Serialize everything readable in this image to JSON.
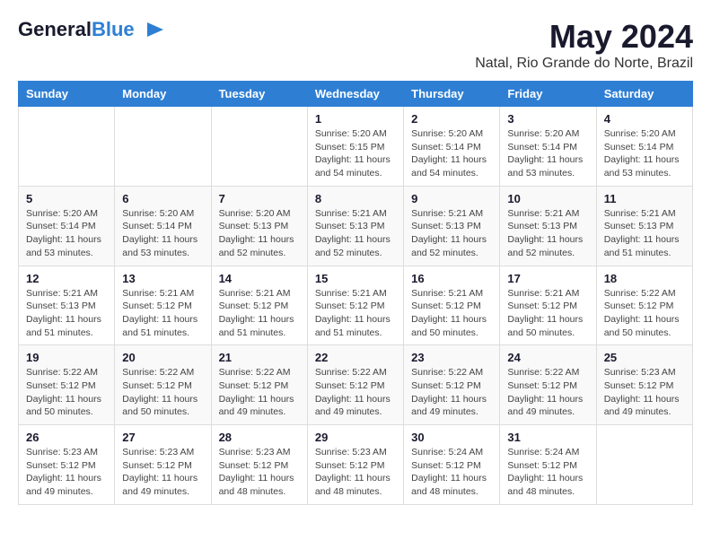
{
  "logo": {
    "general": "General",
    "blue": "Blue"
  },
  "title": {
    "month_year": "May 2024",
    "location": "Natal, Rio Grande do Norte, Brazil"
  },
  "headers": [
    "Sunday",
    "Monday",
    "Tuesday",
    "Wednesday",
    "Thursday",
    "Friday",
    "Saturday"
  ],
  "weeks": [
    [
      {
        "day": "",
        "sunrise": "",
        "sunset": "",
        "daylight": ""
      },
      {
        "day": "",
        "sunrise": "",
        "sunset": "",
        "daylight": ""
      },
      {
        "day": "",
        "sunrise": "",
        "sunset": "",
        "daylight": ""
      },
      {
        "day": "1",
        "sunrise": "Sunrise: 5:20 AM",
        "sunset": "Sunset: 5:15 PM",
        "daylight": "Daylight: 11 hours and 54 minutes."
      },
      {
        "day": "2",
        "sunrise": "Sunrise: 5:20 AM",
        "sunset": "Sunset: 5:14 PM",
        "daylight": "Daylight: 11 hours and 54 minutes."
      },
      {
        "day": "3",
        "sunrise": "Sunrise: 5:20 AM",
        "sunset": "Sunset: 5:14 PM",
        "daylight": "Daylight: 11 hours and 53 minutes."
      },
      {
        "day": "4",
        "sunrise": "Sunrise: 5:20 AM",
        "sunset": "Sunset: 5:14 PM",
        "daylight": "Daylight: 11 hours and 53 minutes."
      }
    ],
    [
      {
        "day": "5",
        "sunrise": "Sunrise: 5:20 AM",
        "sunset": "Sunset: 5:14 PM",
        "daylight": "Daylight: 11 hours and 53 minutes."
      },
      {
        "day": "6",
        "sunrise": "Sunrise: 5:20 AM",
        "sunset": "Sunset: 5:14 PM",
        "daylight": "Daylight: 11 hours and 53 minutes."
      },
      {
        "day": "7",
        "sunrise": "Sunrise: 5:20 AM",
        "sunset": "Sunset: 5:13 PM",
        "daylight": "Daylight: 11 hours and 52 minutes."
      },
      {
        "day": "8",
        "sunrise": "Sunrise: 5:21 AM",
        "sunset": "Sunset: 5:13 PM",
        "daylight": "Daylight: 11 hours and 52 minutes."
      },
      {
        "day": "9",
        "sunrise": "Sunrise: 5:21 AM",
        "sunset": "Sunset: 5:13 PM",
        "daylight": "Daylight: 11 hours and 52 minutes."
      },
      {
        "day": "10",
        "sunrise": "Sunrise: 5:21 AM",
        "sunset": "Sunset: 5:13 PM",
        "daylight": "Daylight: 11 hours and 52 minutes."
      },
      {
        "day": "11",
        "sunrise": "Sunrise: 5:21 AM",
        "sunset": "Sunset: 5:13 PM",
        "daylight": "Daylight: 11 hours and 51 minutes."
      }
    ],
    [
      {
        "day": "12",
        "sunrise": "Sunrise: 5:21 AM",
        "sunset": "Sunset: 5:13 PM",
        "daylight": "Daylight: 11 hours and 51 minutes."
      },
      {
        "day": "13",
        "sunrise": "Sunrise: 5:21 AM",
        "sunset": "Sunset: 5:12 PM",
        "daylight": "Daylight: 11 hours and 51 minutes."
      },
      {
        "day": "14",
        "sunrise": "Sunrise: 5:21 AM",
        "sunset": "Sunset: 5:12 PM",
        "daylight": "Daylight: 11 hours and 51 minutes."
      },
      {
        "day": "15",
        "sunrise": "Sunrise: 5:21 AM",
        "sunset": "Sunset: 5:12 PM",
        "daylight": "Daylight: 11 hours and 51 minutes."
      },
      {
        "day": "16",
        "sunrise": "Sunrise: 5:21 AM",
        "sunset": "Sunset: 5:12 PM",
        "daylight": "Daylight: 11 hours and 50 minutes."
      },
      {
        "day": "17",
        "sunrise": "Sunrise: 5:21 AM",
        "sunset": "Sunset: 5:12 PM",
        "daylight": "Daylight: 11 hours and 50 minutes."
      },
      {
        "day": "18",
        "sunrise": "Sunrise: 5:22 AM",
        "sunset": "Sunset: 5:12 PM",
        "daylight": "Daylight: 11 hours and 50 minutes."
      }
    ],
    [
      {
        "day": "19",
        "sunrise": "Sunrise: 5:22 AM",
        "sunset": "Sunset: 5:12 PM",
        "daylight": "Daylight: 11 hours and 50 minutes."
      },
      {
        "day": "20",
        "sunrise": "Sunrise: 5:22 AM",
        "sunset": "Sunset: 5:12 PM",
        "daylight": "Daylight: 11 hours and 50 minutes."
      },
      {
        "day": "21",
        "sunrise": "Sunrise: 5:22 AM",
        "sunset": "Sunset: 5:12 PM",
        "daylight": "Daylight: 11 hours and 49 minutes."
      },
      {
        "day": "22",
        "sunrise": "Sunrise: 5:22 AM",
        "sunset": "Sunset: 5:12 PM",
        "daylight": "Daylight: 11 hours and 49 minutes."
      },
      {
        "day": "23",
        "sunrise": "Sunrise: 5:22 AM",
        "sunset": "Sunset: 5:12 PM",
        "daylight": "Daylight: 11 hours and 49 minutes."
      },
      {
        "day": "24",
        "sunrise": "Sunrise: 5:22 AM",
        "sunset": "Sunset: 5:12 PM",
        "daylight": "Daylight: 11 hours and 49 minutes."
      },
      {
        "day": "25",
        "sunrise": "Sunrise: 5:23 AM",
        "sunset": "Sunset: 5:12 PM",
        "daylight": "Daylight: 11 hours and 49 minutes."
      }
    ],
    [
      {
        "day": "26",
        "sunrise": "Sunrise: 5:23 AM",
        "sunset": "Sunset: 5:12 PM",
        "daylight": "Daylight: 11 hours and 49 minutes."
      },
      {
        "day": "27",
        "sunrise": "Sunrise: 5:23 AM",
        "sunset": "Sunset: 5:12 PM",
        "daylight": "Daylight: 11 hours and 49 minutes."
      },
      {
        "day": "28",
        "sunrise": "Sunrise: 5:23 AM",
        "sunset": "Sunset: 5:12 PM",
        "daylight": "Daylight: 11 hours and 48 minutes."
      },
      {
        "day": "29",
        "sunrise": "Sunrise: 5:23 AM",
        "sunset": "Sunset: 5:12 PM",
        "daylight": "Daylight: 11 hours and 48 minutes."
      },
      {
        "day": "30",
        "sunrise": "Sunrise: 5:24 AM",
        "sunset": "Sunset: 5:12 PM",
        "daylight": "Daylight: 11 hours and 48 minutes."
      },
      {
        "day": "31",
        "sunrise": "Sunrise: 5:24 AM",
        "sunset": "Sunset: 5:12 PM",
        "daylight": "Daylight: 11 hours and 48 minutes."
      },
      {
        "day": "",
        "sunrise": "",
        "sunset": "",
        "daylight": ""
      }
    ]
  ]
}
